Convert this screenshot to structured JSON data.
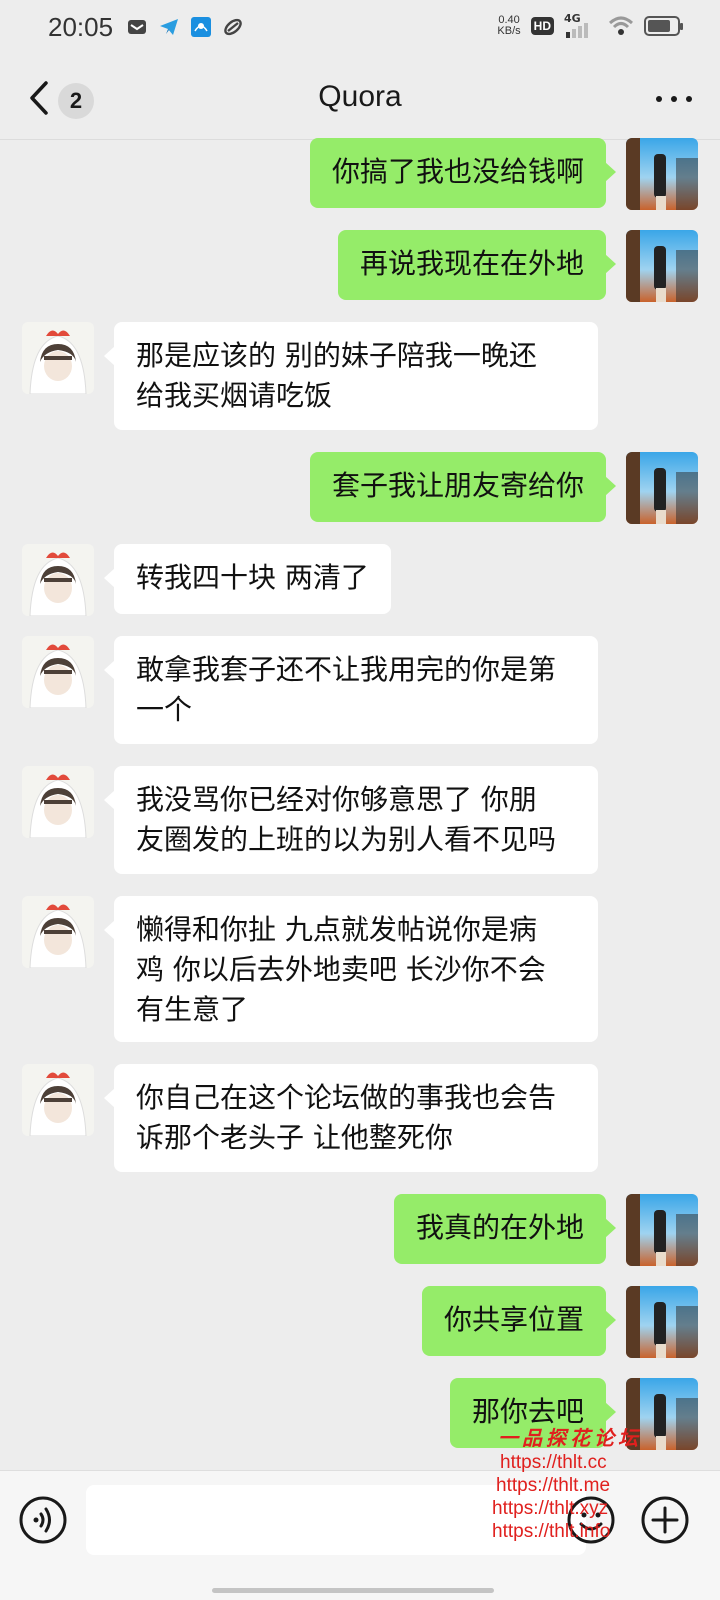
{
  "status_bar": {
    "time": "20:05",
    "net_speed_value": "0.40",
    "net_speed_unit": "KB/s",
    "hd_label": "HD",
    "network_label": "4G",
    "icons": [
      "mail-icon",
      "telegram-icon",
      "wifi-app-icon",
      "link-icon",
      "wifi-signal-icon",
      "battery-icon"
    ]
  },
  "header": {
    "back_icon": "chevron-left-icon",
    "unread_count": "2",
    "title": "Quora",
    "more_icon": "more-dots-icon"
  },
  "messages": [
    {
      "from": "me",
      "text": "你搞了我也没给钱啊"
    },
    {
      "from": "me",
      "text": "再说我现在在外地"
    },
    {
      "from": "them",
      "lines": [
        "那是应该的 别的妹子陪我一晚还",
        "给我买烟请吃饭"
      ]
    },
    {
      "from": "me",
      "text": "套子我让朋友寄给你"
    },
    {
      "from": "them",
      "text": "转我四十块 两清了"
    },
    {
      "from": "them",
      "lines": [
        "敢拿我套子还不让我用完的你是第",
        "一个"
      ]
    },
    {
      "from": "them",
      "lines": [
        "我没骂你已经对你够意思了 你朋",
        "友圈发的上班的以为别人看不见吗"
      ]
    },
    {
      "from": "them",
      "lines": [
        "懒得和你扯 九点就发帖说你是病",
        "鸡 你以后去外地卖吧 长沙你不会",
        "有生意了"
      ]
    },
    {
      "from": "them",
      "lines": [
        "你自己在这个论坛做的事我也会告",
        "诉那个老头子 让他整死你"
      ]
    },
    {
      "from": "me",
      "text": "我真的在外地"
    },
    {
      "from": "me",
      "text": "你共享位置"
    },
    {
      "from": "me",
      "text": "那你去吧"
    }
  ],
  "input_bar": {
    "voice_icon": "voice-icon",
    "emoji_icon": "emoji-icon",
    "plus_icon": "plus-icon"
  },
  "watermark": {
    "title": "一品探花论坛",
    "links": [
      "https://thlt.cc",
      "https://thlt.me",
      "https://thlt.xyz",
      "https://thlt.info"
    ]
  },
  "colors": {
    "background": "#ededed",
    "my_bubble": "#95ec69",
    "their_bubble": "#ffffff",
    "watermark": "#e0201e"
  }
}
